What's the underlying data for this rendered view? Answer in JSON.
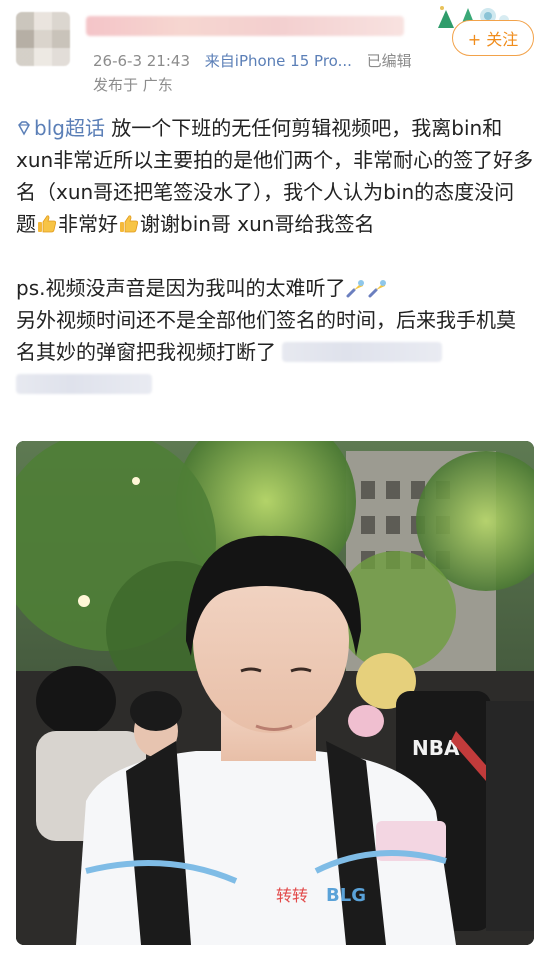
{
  "post": {
    "timestamp": "26-6-3 21:43",
    "device": "来自iPhone 15 Pro...",
    "edited": "已编辑",
    "location": "发布于 广东",
    "follow_label": "+ 关注",
    "tag": "blg超话",
    "text1": " 放一个下班的无任何剪辑视频吧，我离bin和xun非常近所以主要拍的是他们两个，非常耐心的签了好多名（xun哥还把笔签没水了），我个人认为bin的态度没问题",
    "text2": "非常好",
    "text3": "谢谢bin哥 xun哥给我签名",
    "text4": "ps.视频没声音是因为我叫的太难听了",
    "text5": "另外视频时间还不是全部他们签名的时间，后来我手机莫名其妙的弹窗把我视频打断了"
  },
  "photo": {
    "shirt_brand": "BLG",
    "shirt_sponsor": "转转",
    "jersey_text": "NBA"
  },
  "colors": {
    "link": "#5b7fb7",
    "follow": "#f08c1b",
    "meta": "#8c8c8c"
  }
}
